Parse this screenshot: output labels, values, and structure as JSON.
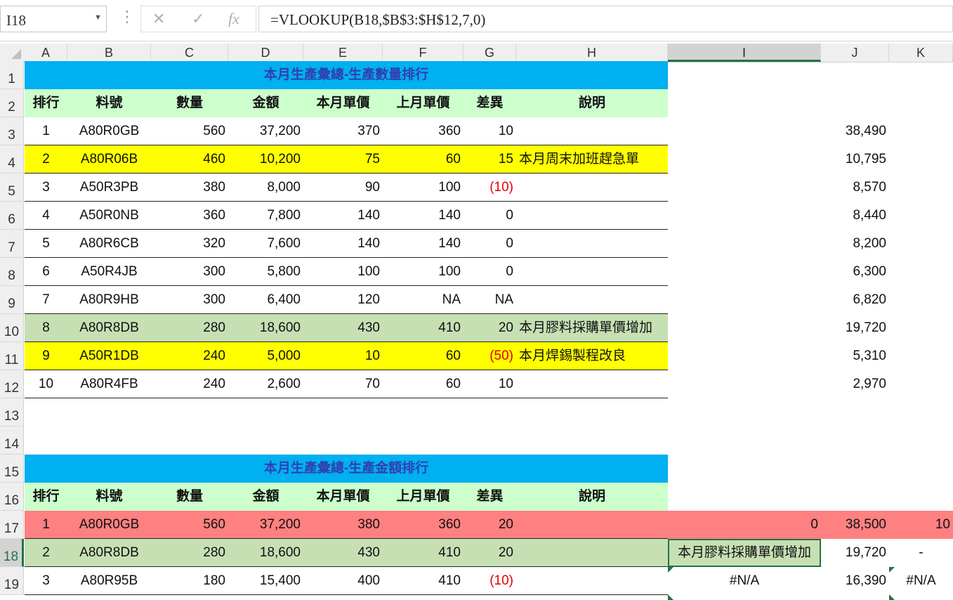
{
  "formula_bar": {
    "name_box": "I18",
    "cancel_icon": "✕",
    "enter_icon": "✓",
    "fx_label": "fx",
    "formula": "=VLOOKUP(B18,$B$3:$H$12,7,0)"
  },
  "columns": [
    "A",
    "B",
    "C",
    "D",
    "E",
    "F",
    "G",
    "H",
    "I",
    "J",
    "K"
  ],
  "rows": [
    "1",
    "2",
    "3",
    "4",
    "5",
    "6",
    "7",
    "8",
    "9",
    "10",
    "11",
    "12",
    "13",
    "14",
    "15",
    "16",
    "17",
    "18",
    "19"
  ],
  "table1": {
    "title": "本月生產彙總-生產數量排行",
    "headers": [
      "排行",
      "料號",
      "數量",
      "金額",
      "本月單價",
      "上月單價",
      "差異",
      "說明"
    ],
    "data": [
      [
        "1",
        "A80R0GB",
        "560",
        "37,200",
        "370",
        "360",
        "10",
        "",
        "38,490"
      ],
      [
        "2",
        "A80R06B",
        "460",
        "10,200",
        "75",
        "60",
        "15",
        "本月周末加班趕急單",
        "10,795"
      ],
      [
        "3",
        "A50R3PB",
        "380",
        "8,000",
        "90",
        "100",
        "(10)",
        "",
        "8,570"
      ],
      [
        "4",
        "A50R0NB",
        "360",
        "7,800",
        "140",
        "140",
        "0",
        "",
        "8,440"
      ],
      [
        "5",
        "A80R6CB",
        "320",
        "7,600",
        "140",
        "140",
        "0",
        "",
        "8,200"
      ],
      [
        "6",
        "A50R4JB",
        "300",
        "5,800",
        "100",
        "100",
        "0",
        "",
        "6,300"
      ],
      [
        "7",
        "A80R9HB",
        "300",
        "6,400",
        "120",
        "NA",
        "NA",
        "",
        "6,820"
      ],
      [
        "8",
        "A80R8DB",
        "280",
        "18,600",
        "430",
        "410",
        "20",
        "本月膠料採購單價增加",
        "19,720"
      ],
      [
        "9",
        "A50R1DB",
        "240",
        "5,000",
        "10",
        "60",
        "(50)",
        "本月焊錫製程改良",
        "5,310"
      ],
      [
        "10",
        "A80R4FB",
        "240",
        "2,600",
        "70",
        "60",
        "10",
        "",
        "2,970"
      ]
    ]
  },
  "table2": {
    "title": "本月生產彙總-生產金額排行",
    "headers": [
      "排行",
      "料號",
      "數量",
      "金額",
      "本月單價",
      "上月單價",
      "差異",
      "說明"
    ],
    "data": [
      [
        "1",
        "A80R0GB",
        "560",
        "37,200",
        "380",
        "360",
        "20",
        "",
        "0",
        "38,500",
        "10"
      ],
      [
        "2",
        "A80R8DB",
        "280",
        "18,600",
        "430",
        "410",
        "20",
        "",
        "本月膠料採購單價增加",
        "19,720",
        "-"
      ],
      [
        "3",
        "A80R95B",
        "180",
        "15,400",
        "400",
        "410",
        "(10)",
        "",
        "#N/A",
        "16,390",
        "#N/A"
      ]
    ]
  },
  "colors": {
    "title_bg": "#00b0f0",
    "header_bg": "#ccffcc",
    "yellow": "#ffff00",
    "green_row": "#c6e0b4",
    "red_row": "#ff8080",
    "accent": "#217346"
  }
}
